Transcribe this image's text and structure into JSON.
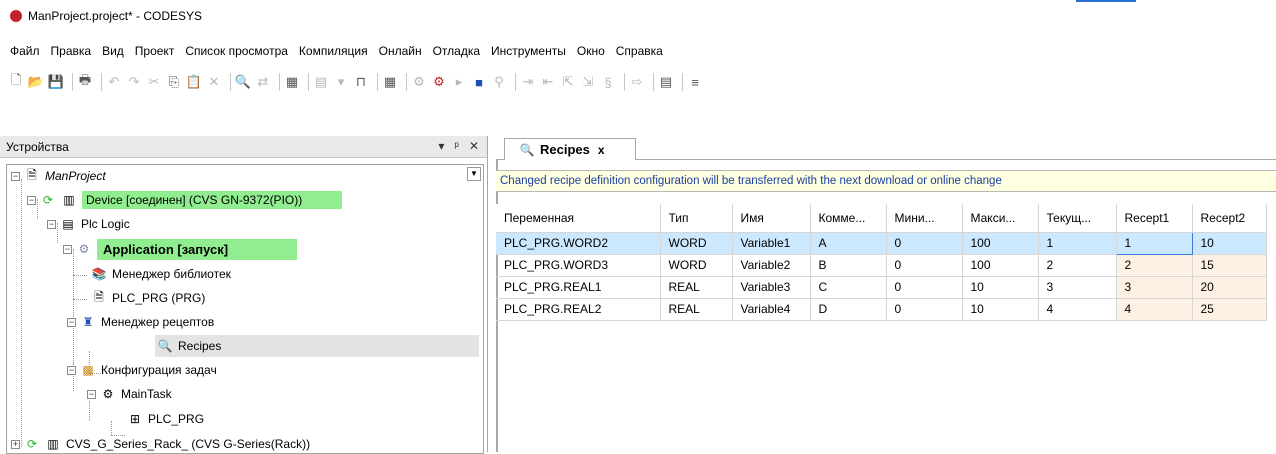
{
  "window": {
    "title": "ManProject.project* - CODESYS",
    "accent_color": "#2a6fd6"
  },
  "menu": [
    "Файл",
    "Правка",
    "Вид",
    "Проект",
    "Список просмотра",
    "Компиляция",
    "Онлайн",
    "Отладка",
    "Инструменты",
    "Окно",
    "Справка"
  ],
  "devices_panel": {
    "title": "Устройства",
    "buttons": [
      "▾",
      "ᵖ",
      "✕"
    ],
    "tree": {
      "root": "ManProject",
      "device": "Device [соединен] (CVS GN-9372(PIO))",
      "plc_logic": "Plc Logic",
      "application": "Application [запуск]",
      "library_manager": "Менеджер библиотек",
      "plc_prg": "PLC_PRG (PRG)",
      "recipe_manager": "Менеджер рецептов",
      "recipes": "Recipes",
      "task_config": "Конфигурация задач",
      "main_task": "MainTask",
      "task_plc_prg": "PLC_PRG",
      "rack": "CVS_G_Series_Rack_ (CVS G-Series(Rack))"
    },
    "highlight_color": "#90ee90"
  },
  "editor": {
    "tab_label": "Recipes",
    "tab_close": "x",
    "info_message": "Changed recipe definition configuration will be transferred with the next download or online change",
    "columns": [
      "Переменная",
      "Тип",
      "Имя",
      "Комме...",
      "Мини...",
      "Макси...",
      "Текущ...",
      "Recept1",
      "Recept2"
    ],
    "rows": [
      [
        "PLC_PRG.WORD2",
        "WORD",
        "Variable1",
        "A",
        "0",
        "100",
        "1",
        "1",
        "10"
      ],
      [
        "PLC_PRG.WORD3",
        "WORD",
        "Variable2",
        "B",
        "0",
        "100",
        "2",
        "2",
        "15"
      ],
      [
        "PLC_PRG.REAL1",
        "REAL",
        "Variable3",
        "C",
        "0",
        "10",
        "3",
        "3",
        "20"
      ],
      [
        "PLC_PRG.REAL2",
        "REAL",
        "Variable4",
        "D",
        "0",
        "10",
        "4",
        "4",
        "25"
      ]
    ],
    "selected_row": 0,
    "selection_color": "#cce8ff",
    "recipe_cell_color": "#fdf1e3"
  }
}
